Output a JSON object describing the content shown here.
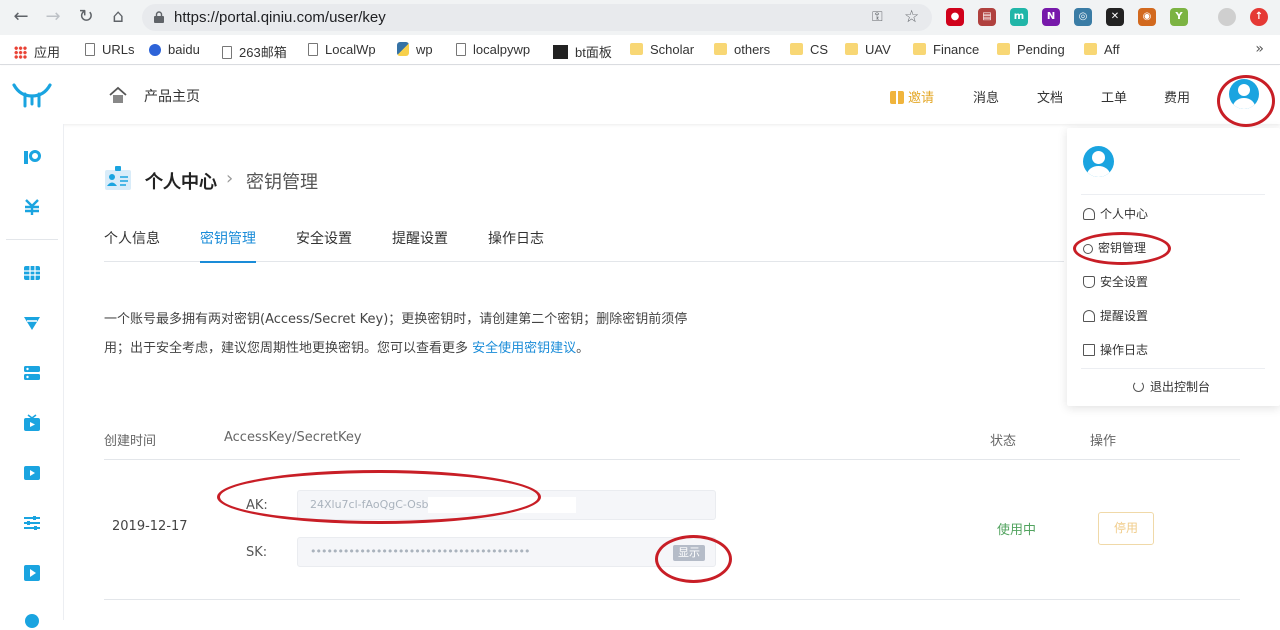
{
  "browser": {
    "url": "https://portal.qiniu.com/user/key",
    "extensions": [
      {
        "name": "adblock-icon",
        "color": "#d0021b",
        "glyph": "●"
      },
      {
        "name": "pdf-extension-icon",
        "color": "#b0413e",
        "glyph": "▤"
      },
      {
        "name": "m-extension-icon",
        "color": "#21b6a8",
        "glyph": "m"
      },
      {
        "name": "onenote-icon",
        "color": "#7719aa",
        "glyph": "N"
      },
      {
        "name": "globe-extension-icon",
        "color": "#3a7ca5",
        "glyph": "◎"
      },
      {
        "name": "x-extension-icon",
        "color": "#222222",
        "glyph": "✕"
      },
      {
        "name": "monkey-extension-icon",
        "color": "#d2691e",
        "glyph": "◉"
      },
      {
        "name": "y-extension-icon",
        "color": "#7cb342",
        "glyph": "Y"
      },
      {
        "name": "profile-icon",
        "color": "#cfcfcf",
        "glyph": ""
      },
      {
        "name": "update-icon",
        "color": "#e53935",
        "glyph": "↑"
      }
    ],
    "bookmarks": [
      {
        "label": "应用",
        "icon": "apps"
      },
      {
        "label": "URLs",
        "icon": "page"
      },
      {
        "label": "baidu",
        "icon": "paw"
      },
      {
        "label": "263邮箱",
        "icon": "page"
      },
      {
        "label": "LocalWp",
        "icon": "page"
      },
      {
        "label": "wp",
        "icon": "python"
      },
      {
        "label": "localpywp",
        "icon": "page"
      },
      {
        "label": "bt面板",
        "icon": "bt"
      },
      {
        "label": "Scholar",
        "icon": "folder"
      },
      {
        "label": "others",
        "icon": "folder"
      },
      {
        "label": "CS",
        "icon": "folder"
      },
      {
        "label": "UAV",
        "icon": "folder"
      },
      {
        "label": "Finance",
        "icon": "folder"
      },
      {
        "label": "Pending",
        "icon": "folder"
      },
      {
        "label": "Aff",
        "icon": "folder"
      }
    ],
    "bookmarks_more": "»"
  },
  "header": {
    "home_label": "产品主页",
    "nav": {
      "invite": "邀请",
      "messages": "消息",
      "docs": "文档",
      "tickets": "工单",
      "billing": "费用"
    }
  },
  "page": {
    "breadcrumb_root": "个人中心",
    "breadcrumb_sep": "›",
    "breadcrumb_current": "密钥管理",
    "tabs": [
      "个人信息",
      "密钥管理",
      "安全设置",
      "提醒设置",
      "操作日志"
    ],
    "active_tab": "密钥管理",
    "desc_line1": "一个账号最多拥有两对密钥(Access/Secret Key)；更换密钥时，请创建第二个密钥；删除密钥前须停",
    "desc_line2": "用；出于安全考虑，建议您周期性地更换密钥。您可以查看更多 ",
    "desc_link": "安全使用密钥建议",
    "desc_end": "。"
  },
  "table": {
    "headers": {
      "created": "创建时间",
      "keys": "AccessKey/SecretKey",
      "status": "状态",
      "actions": "操作"
    },
    "rows": [
      {
        "created": "2019-12-17",
        "ak_label": "AK:",
        "ak_value": "24Xlu7cl-fAoQgC-Osb",
        "sk_label": "SK:",
        "sk_value": "••••••••••••••••••••••••••••••••••••••••",
        "show_label": "显示",
        "status": "使用中",
        "disable_label": "停用"
      }
    ]
  },
  "dropdown": {
    "items": [
      "个人中心",
      "密钥管理",
      "安全设置",
      "提醒设置",
      "操作日志"
    ],
    "logout": "退出控制台"
  },
  "colors": {
    "accent": "#1a8cd8",
    "invite": "#e4a92b",
    "status_active": "#52a35f",
    "annotation_red": "#c81e26"
  }
}
